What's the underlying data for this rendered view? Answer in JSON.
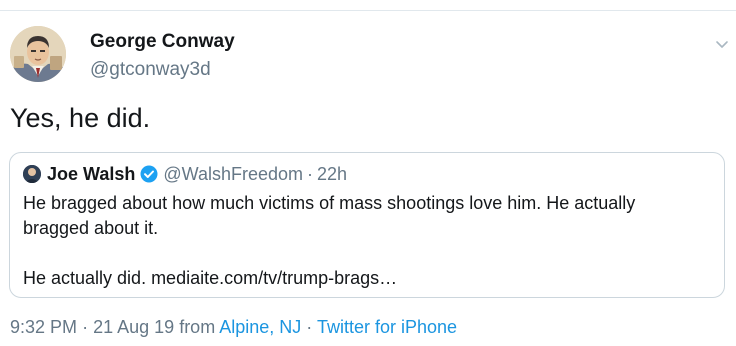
{
  "tweet": {
    "author_name": "George Conway",
    "author_handle": "@gtconway3d",
    "text": "Yes, he did.",
    "avatar_icon": "avatar-portrait-sketch",
    "menu_icon": "chevron-down-icon"
  },
  "quote": {
    "author_name": "Joe Walsh",
    "verified": true,
    "verified_color": "#1da1f2",
    "author_handle": "@WalshFreedom",
    "separator": "·",
    "time": "22h",
    "line1": "He bragged about how much victims of mass shootings love him. He actually",
    "line2": "bragged about it.",
    "line3": "He actually did. mediaite.com/tv/trump-brags…"
  },
  "meta": {
    "time": "9:32 PM",
    "separator": "·",
    "date": "21 Aug 19",
    "from_label": "from",
    "location": "Alpine, NJ",
    "source": "Twitter for iPhone"
  },
  "colors": {
    "text_primary": "#14171a",
    "text_secondary": "#657786",
    "link": "#1b95e0",
    "border": "#ccd6dd"
  }
}
